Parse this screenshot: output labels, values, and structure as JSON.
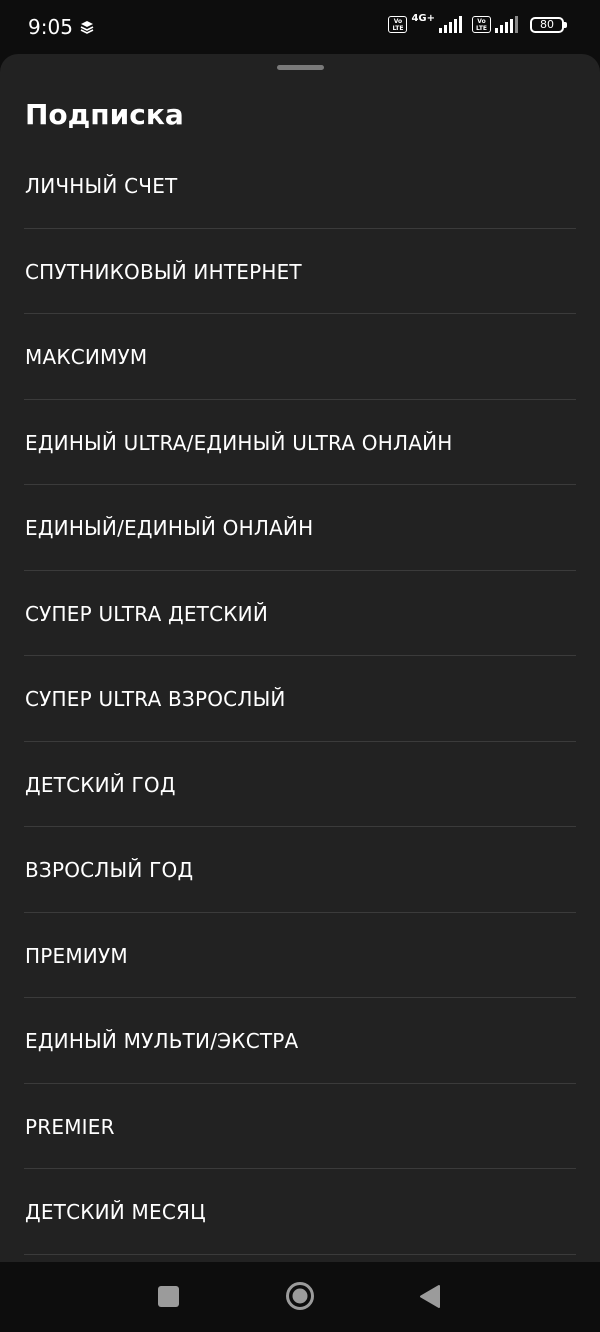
{
  "status_bar": {
    "time": "9:05",
    "volte_label": "Vo LTE",
    "network_type": "4G+",
    "battery_level": "80"
  },
  "sheet": {
    "title": "Подписка",
    "items": [
      {
        "label": "ЛИЧНЫЙ СЧЕТ"
      },
      {
        "label": "СПУТНИКОВЫЙ ИНТЕРНЕТ"
      },
      {
        "label": "МАКСИМУМ"
      },
      {
        "label": "ЕДИНЫЙ ULTRA/ЕДИНЫЙ ULTRA ОНЛАЙН"
      },
      {
        "label": "ЕДИНЫЙ/ЕДИНЫЙ ОНЛАЙН"
      },
      {
        "label": "СУПЕР ULTRA ДЕТСКИЙ"
      },
      {
        "label": "СУПЕР ULTRA ВЗРОСЛЫЙ"
      },
      {
        "label": "ДЕТСКИЙ ГОД"
      },
      {
        "label": "ВЗРОСЛЫЙ ГОД"
      },
      {
        "label": "ПРЕМИУМ"
      },
      {
        "label": "ЕДИНЫЙ МУЛЬТИ/ЭКСТРА"
      },
      {
        "label": "PREMIER"
      },
      {
        "label": "ДЕТСКИЙ МЕСЯЦ"
      }
    ]
  },
  "nav_bar": {
    "icons": [
      "recents-icon",
      "home-icon",
      "back-icon"
    ]
  },
  "colors": {
    "sheet_background": "#222222",
    "system_background": "#0d0d0d",
    "divider": "#3b3b3b",
    "text": "#ffffff"
  }
}
